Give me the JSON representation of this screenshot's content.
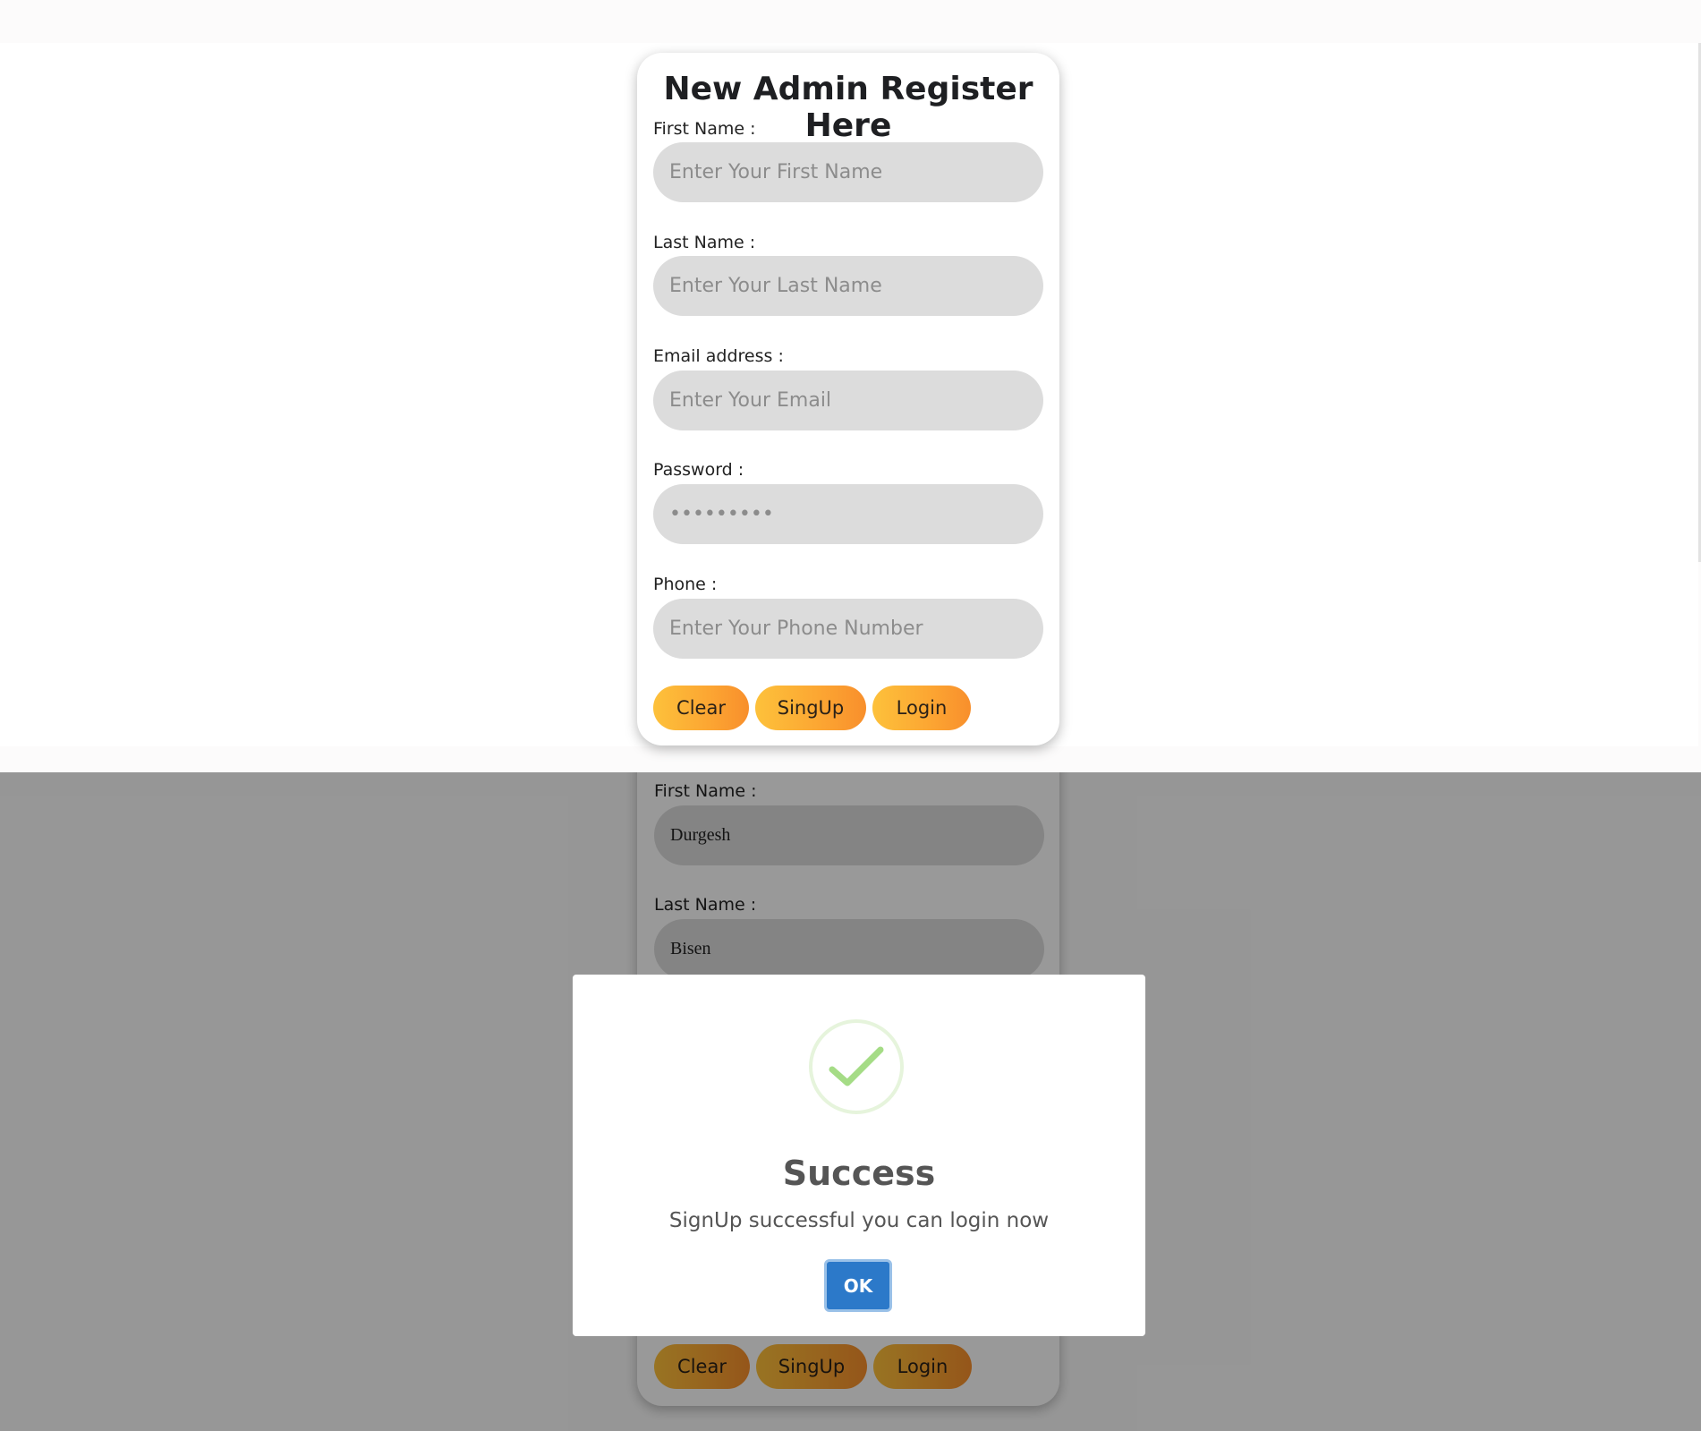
{
  "register_form": {
    "title": "New Admin Register Here",
    "first_name": {
      "label": "First Name :",
      "placeholder": "Enter Your First Name"
    },
    "last_name": {
      "label": "Last Name :",
      "placeholder": "Enter Your Last Name"
    },
    "email": {
      "label": "Email address :",
      "placeholder": "Enter Your Email"
    },
    "password": {
      "label": "Password :",
      "placeholder": "•••••••••"
    },
    "phone": {
      "label": "Phone :",
      "placeholder": "Enter Your Phone Number"
    },
    "buttons": {
      "clear": "Clear",
      "signup": "SingUp",
      "login": "Login"
    }
  },
  "filled_form": {
    "first_name": {
      "label": "First Name :",
      "value": "Durgesh"
    },
    "last_name": {
      "label": "Last Name :",
      "value": "Bisen"
    },
    "buttons": {
      "clear": "Clear",
      "signup": "SingUp",
      "login": "Login"
    }
  },
  "alert": {
    "icon": "checkmark-icon",
    "title": "Success",
    "message": "SignUp successful you can login now",
    "ok_label": "OK",
    "colors": {
      "check": "#a5dc86",
      "ok_button": "#2c79c9"
    }
  },
  "colors": {
    "button_gradient_start": "#fdc13b",
    "button_gradient_end": "#f88f2c",
    "input_bg": "#dcdcdc"
  }
}
